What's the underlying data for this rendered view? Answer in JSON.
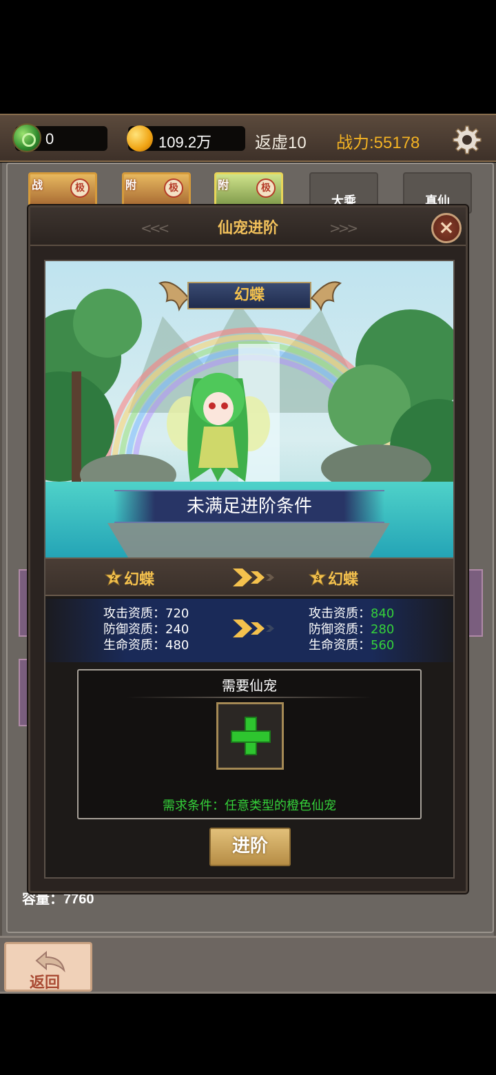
{
  "topbar": {
    "jade_count": "0",
    "gold_count": "109.2万",
    "rebirth": "返虚10",
    "power": "战力:55178"
  },
  "tabs": [
    {
      "tag": "战",
      "seal": "极",
      "style": "card"
    },
    {
      "tag": "附",
      "seal": "极",
      "style": "card"
    },
    {
      "tag": "附",
      "seal": "极",
      "style": "card-selected"
    },
    {
      "label": "大乘",
      "style": "gray"
    },
    {
      "label": "真仙",
      "style": "gray"
    }
  ],
  "background": {
    "capacity": "容量：7760"
  },
  "bottom": {
    "back_label": "返回"
  },
  "dialog": {
    "title": "仙宠进阶",
    "pet_name": "幻蝶",
    "status": "未满足进阶条件",
    "current": {
      "stars": "2",
      "name": "幻蝶",
      "stats": [
        {
          "label": "攻击资质：",
          "value": "720"
        },
        {
          "label": "防御资质：",
          "value": "240"
        },
        {
          "label": "生命资质：",
          "value": "480"
        }
      ]
    },
    "next": {
      "stars": "3",
      "name": "幻蝶",
      "stats": [
        {
          "label": "攻击资质：",
          "value": "840"
        },
        {
          "label": "防御资质：",
          "value": "280"
        },
        {
          "label": "生命资质：",
          "value": "560"
        }
      ]
    },
    "requirement": {
      "title": "需要仙宠",
      "condition": "需求条件：任意类型的橙色仙宠"
    },
    "advance_button": "进阶"
  },
  "colors": {
    "gold_text": "#f4c14d",
    "power_text": "#f4b323",
    "upgrade_green": "#35d23a"
  }
}
